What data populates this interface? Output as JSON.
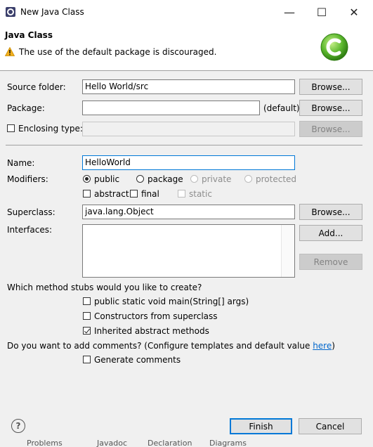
{
  "window": {
    "title": "New Java Class",
    "minimize_glyph": "—",
    "maximize_glyph": "☐",
    "close_glyph": "✕"
  },
  "header": {
    "title": "Java Class",
    "message": "The use of the default package is discouraged."
  },
  "form": {
    "source_folder": {
      "label": "Source folder:",
      "value": "Hello World/src",
      "button": "Browse..."
    },
    "package": {
      "label": "Package:",
      "value": "",
      "suffix": "(default)",
      "button": "Browse..."
    },
    "enclosing_type": {
      "label": "Enclosing type:",
      "checked": false,
      "value": "",
      "button": "Browse..."
    },
    "name": {
      "label": "Name:",
      "value": "HelloWorld"
    },
    "modifiers": {
      "label": "Modifiers:",
      "options": [
        "public",
        "package",
        "private",
        "protected"
      ],
      "selected": "public",
      "checks": [
        "abstract",
        "final",
        "static"
      ]
    },
    "superclass": {
      "label": "Superclass:",
      "value": "java.lang.Object",
      "button": "Browse..."
    },
    "interfaces": {
      "label": "Interfaces:",
      "add_button": "Add...",
      "remove_button": "Remove"
    }
  },
  "stubs": {
    "question": "Which method stubs would you like to create?",
    "options": [
      {
        "label": "public static void main(String[] args)",
        "checked": false
      },
      {
        "label": "Constructors from superclass",
        "checked": false
      },
      {
        "label": "Inherited abstract methods",
        "checked": true
      }
    ]
  },
  "comments": {
    "question_prefix": "Do you want to add comments? (Configure templates and default value ",
    "link": "here",
    "question_suffix": ")",
    "option": "Generate comments"
  },
  "footer": {
    "help_glyph": "?",
    "finish": "Finish",
    "cancel": "Cancel"
  },
  "background_tabs": [
    "Problems",
    "Javadoc",
    "Declaration",
    "Diagrams"
  ],
  "colors": {
    "accent": "#0078d7",
    "logo_green": "#5cb82e",
    "warning": "#f2b01e"
  }
}
